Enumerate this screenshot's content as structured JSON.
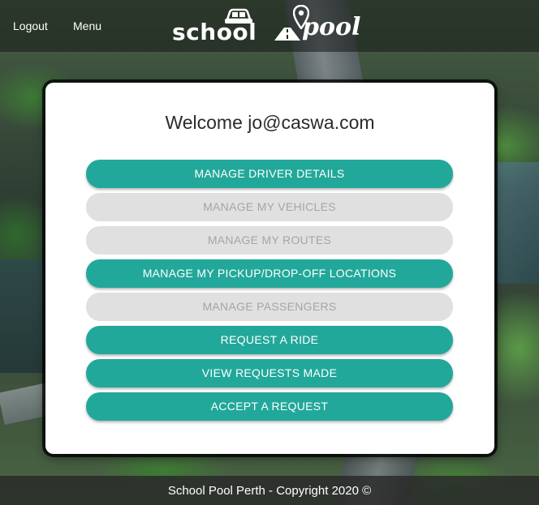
{
  "header": {
    "nav": {
      "logout": "Logout",
      "menu": "Menu"
    },
    "logo": {
      "school": "school",
      "pool": "pool"
    }
  },
  "main": {
    "welcome": "Welcome jo@caswa.com",
    "buttons": [
      {
        "label": "MANAGE DRIVER DETAILS",
        "enabled": true
      },
      {
        "label": "MANAGE MY VEHICLES",
        "enabled": false
      },
      {
        "label": "MANAGE MY ROUTES",
        "enabled": false
      },
      {
        "label": "MANAGE MY PICKUP/DROP-OFF LOCATIONS",
        "enabled": true
      },
      {
        "label": "MANAGE PASSENGERS",
        "enabled": false
      },
      {
        "label": "REQUEST A RIDE",
        "enabled": true
      },
      {
        "label": "VIEW REQUESTS MADE",
        "enabled": true
      },
      {
        "label": "ACCEPT A REQUEST",
        "enabled": true
      }
    ]
  },
  "footer": {
    "text": "School Pool Perth - Copyright 2020 ©"
  },
  "colors": {
    "accent": "#22a89a",
    "disabled_bg": "#e0e0e0",
    "disabled_text": "#a5a5a5"
  },
  "icons": {
    "logo_car": "car-icon",
    "logo_pin": "map-pin-icon",
    "logo_road": "road-icon"
  }
}
